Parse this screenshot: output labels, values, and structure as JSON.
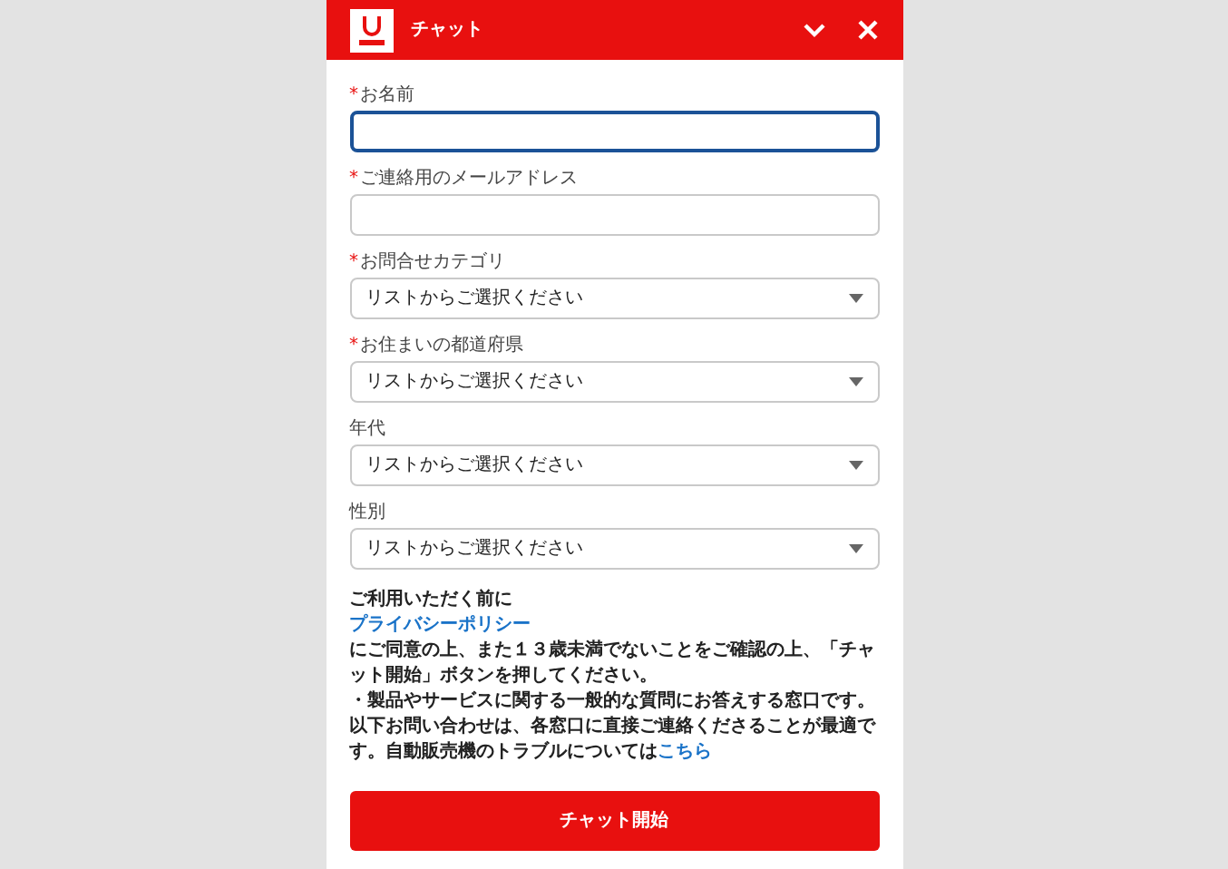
{
  "header": {
    "title": "チャット"
  },
  "fields": [
    {
      "kind": "text",
      "label": "お名前",
      "required_mark": "*",
      "focused": true
    },
    {
      "kind": "text",
      "label": "ご連絡用のメールアドレス",
      "required_mark": "*",
      "focused": false
    },
    {
      "kind": "select",
      "label": "お問合せカテゴリ",
      "required_mark": "*",
      "value": "リストからご選択ください"
    },
    {
      "kind": "select",
      "label": "お住まいの都道府県",
      "required_mark": "*",
      "value": "リストからご選択ください"
    },
    {
      "kind": "select",
      "label": "年代",
      "value": "リストからご選択ください"
    },
    {
      "kind": "select",
      "label": "性別",
      "value": "リストからご選択ください"
    }
  ],
  "notice": {
    "heading": "ご利用いただく前に",
    "policy_link": "プライバシーポリシー",
    "consent": "にご同意の上、また１３歳未満でないことをご確認の上、「チャット開始」ボタンを押してください。",
    "info": "・製品やサービスに関する一般的な質問にお答えする窓口です。以下お問い合わせは、各窓口に直接ご連絡くださることが最適です。自動販売機のトラブルについては",
    "info_link": "こちら"
  },
  "submit": {
    "label": "チャット開始"
  }
}
